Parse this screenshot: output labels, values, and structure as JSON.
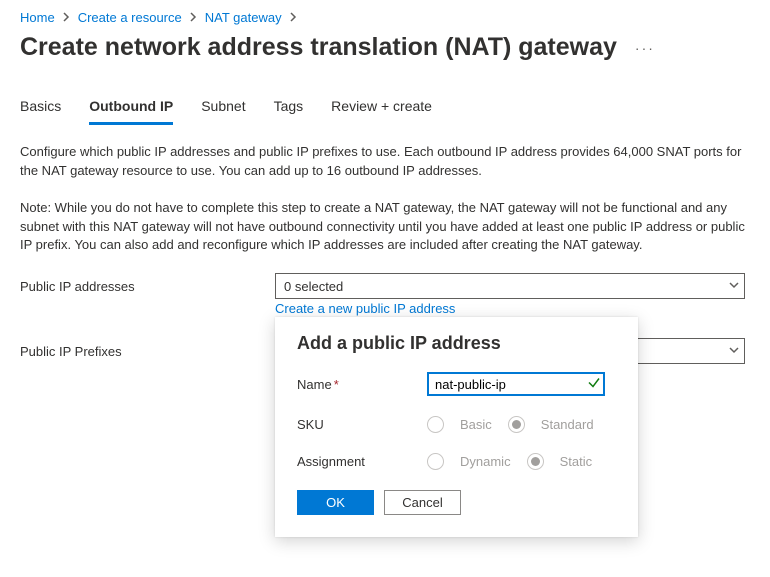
{
  "breadcrumb": {
    "home": "Home",
    "create_resource": "Create a resource",
    "nat_gateway": "NAT gateway"
  },
  "page_title": "Create network address translation (NAT) gateway",
  "tabs": [
    {
      "label": "Basics"
    },
    {
      "label": "Outbound IP"
    },
    {
      "label": "Subnet"
    },
    {
      "label": "Tags"
    },
    {
      "label": "Review + create"
    }
  ],
  "active_tab_index": 1,
  "description_1": "Configure which public IP addresses and public IP prefixes to use. Each outbound IP address provides 64,000 SNAT ports for the NAT gateway resource to use. You can add up to 16 outbound IP addresses.",
  "description_2": "Note: While you do not have to complete this step to create a NAT gateway, the NAT gateway will not be functional and any subnet with this NAT gateway will not have outbound connectivity until you have added at least one public IP address or public IP prefix. You can also add and reconfigure which IP addresses are included after creating the NAT gateway.",
  "public_ip_addresses": {
    "label": "Public IP addresses",
    "selected_text": "0 selected",
    "create_link": "Create a new public IP address"
  },
  "public_ip_prefixes": {
    "label": "Public IP Prefixes"
  },
  "popover": {
    "title": "Add a public IP address",
    "name_label": "Name",
    "name_value": "nat-public-ip",
    "sku_label": "SKU",
    "sku_options": {
      "basic": "Basic",
      "standard": "Standard"
    },
    "sku_selected": "standard",
    "assignment_label": "Assignment",
    "assignment_options": {
      "dynamic": "Dynamic",
      "static": "Static"
    },
    "assignment_selected": "static",
    "ok_label": "OK",
    "cancel_label": "Cancel"
  }
}
